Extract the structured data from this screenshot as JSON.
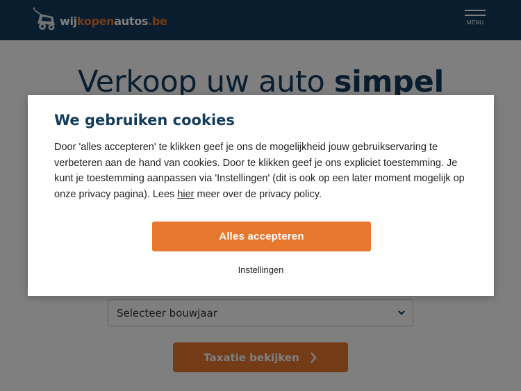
{
  "header": {
    "logo": {
      "part1": "wij",
      "part2": "kopen",
      "part3": "autos",
      "part4": ".be",
      "icon": "tow-car-icon"
    },
    "menu_label": "MENU"
  },
  "hero": {
    "title_regular": "Verkoop uw auto ",
    "title_bold": "simpel"
  },
  "form": {
    "year_select": "Selecteer bouwjaar",
    "submit_label": "Taxatie bekijken"
  },
  "cookie_modal": {
    "title": "We gebruiken cookies",
    "text_before_link": "Door 'alles accepteren' te klikken geef je ons de mogelijkheid jouw gebruikservaring te verbeteren aan de hand van cookies. Door te klikken geef je ons expliciet toestemming. Je kunt je toestemming aanpassen via 'Instellingen' (dit is ook op een later moment mogelijk op onze privacy pagina). Lees ",
    "link_text": "hier",
    "text_after_link": " meer over de privacy policy.",
    "accept_label": "Alles accepteren",
    "settings_label": "Instellingen"
  },
  "colors": {
    "navy": "#133b5c",
    "orange": "#e8772e"
  }
}
